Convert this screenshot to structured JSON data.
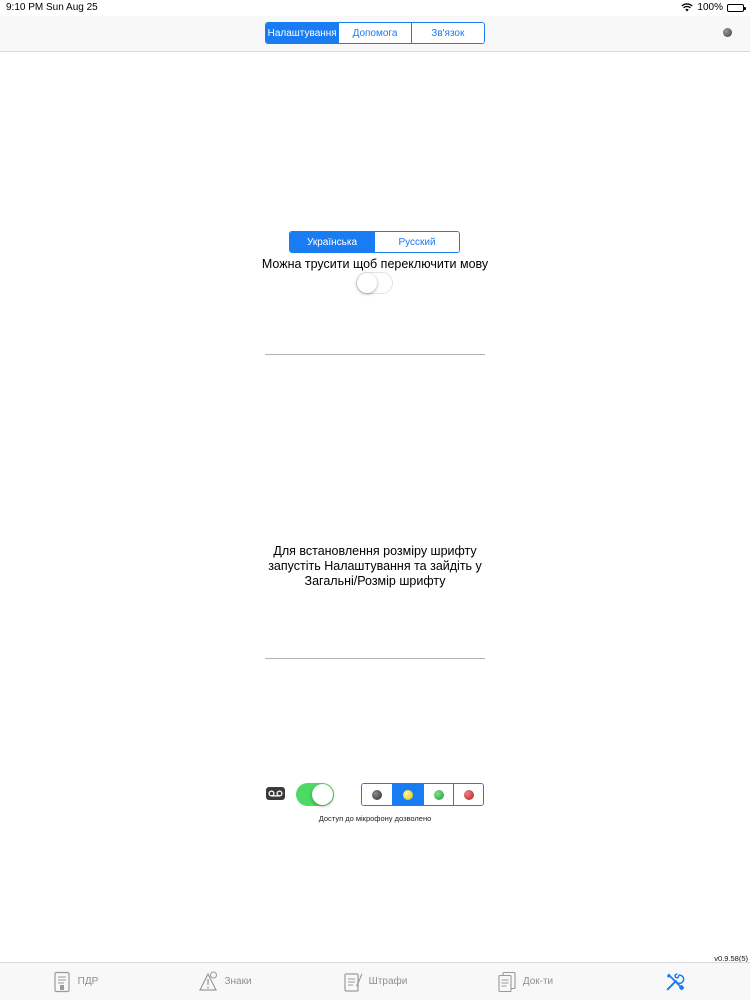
{
  "status_bar": {
    "time": "9:10 PM",
    "date": "Sun Aug 25",
    "battery": "100%"
  },
  "header": {
    "segments": [
      {
        "label": "Налаштування",
        "selected": true
      },
      {
        "label": "Допомога",
        "selected": false
      },
      {
        "label": "Зв'язок",
        "selected": false
      }
    ]
  },
  "language": {
    "options": [
      {
        "label": "Українська",
        "selected": true
      },
      {
        "label": "Русский",
        "selected": false
      }
    ],
    "shake_label": "Можна трусити щоб переключити мову",
    "shake_enabled": false
  },
  "font_note": {
    "line1": "Для встановлення розміру шрифту",
    "line2": "запустіть Налаштування та зайдіть у",
    "line3": "Загальні/Розмір шрифту"
  },
  "microphone": {
    "enabled": true,
    "caption": "Доступ до мікрофону дозволено",
    "colors": [
      {
        "name": "dark",
        "color": "#4a4a4a",
        "selected": false
      },
      {
        "name": "yellow",
        "color": "#f2e12a",
        "selected": true
      },
      {
        "name": "green",
        "color": "#2bb34a",
        "selected": false
      },
      {
        "name": "red",
        "color": "#c62c2c",
        "selected": false
      }
    ]
  },
  "version": "v0.9.58(5)",
  "tabs": [
    {
      "label": "ПДР",
      "icon": "rules-book-icon",
      "active": false
    },
    {
      "label": "Знаки",
      "icon": "road-sign-icon",
      "active": false
    },
    {
      "label": "Штрафи",
      "icon": "fine-document-icon",
      "active": false
    },
    {
      "label": "Док-ти",
      "icon": "documents-icon",
      "active": false
    },
    {
      "label": "",
      "icon": "tools-icon",
      "active": true
    }
  ]
}
